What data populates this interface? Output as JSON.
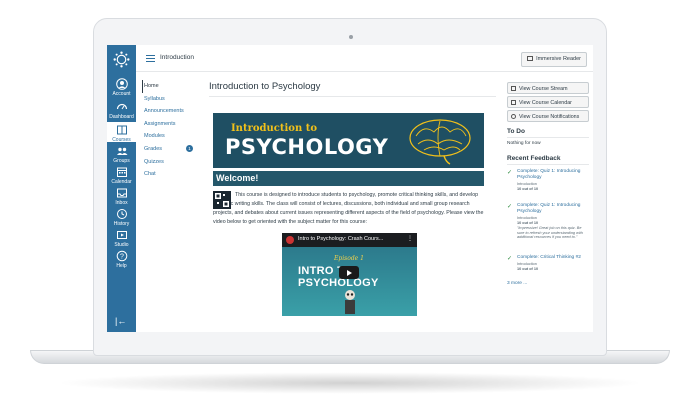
{
  "global_nav": {
    "items": [
      {
        "label": "Account",
        "icon": "account-icon"
      },
      {
        "label": "Dashboard",
        "icon": "dashboard-icon"
      },
      {
        "label": "Courses",
        "icon": "courses-icon"
      },
      {
        "label": "Groups",
        "icon": "groups-icon"
      },
      {
        "label": "Calendar",
        "icon": "calendar-icon"
      },
      {
        "label": "Inbox",
        "icon": "inbox-icon"
      },
      {
        "label": "History",
        "icon": "history-icon"
      },
      {
        "label": "Studio",
        "icon": "studio-icon"
      },
      {
        "label": "Help",
        "icon": "help-icon"
      }
    ],
    "active": "Courses",
    "collapse_glyph": "|←",
    "color": "#2d6f9e"
  },
  "header": {
    "breadcrumb": "Introduction",
    "immersive_reader": "Immersive Reader"
  },
  "course_nav": {
    "items": [
      {
        "label": "Home"
      },
      {
        "label": "Syllabus"
      },
      {
        "label": "Announcements"
      },
      {
        "label": "Assignments"
      },
      {
        "label": "Modules"
      },
      {
        "label": "Grades",
        "badge": "1"
      },
      {
        "label": "Quizzes"
      },
      {
        "label": "Chat"
      }
    ]
  },
  "main": {
    "page_title": "Introduction to Psychology",
    "banner_top": "Introduction to",
    "banner_main": "PSYCHOLOGY",
    "welcome": "Welcome!",
    "body": "This course is designed to introduce students to psychology, promote critical thinking skills, and develop scientific writing skills. The class will consist of lectures, discussions, both individual and small group research projects, and debates about current issues representing different aspects of the field of psychology. Please view the video below to get oriented with the subject matter for this course:",
    "video": {
      "title": "Intro to Psychology: Crash Cours...",
      "episode": "Episode 1",
      "headline": "INTRO TO PSYCHOLOGY"
    }
  },
  "sidebar": {
    "buttons": [
      {
        "label": "View Course Stream"
      },
      {
        "label": "View Course Calendar"
      },
      {
        "label": "View Course Notifications"
      }
    ],
    "todo_title": "To Do",
    "todo_empty": "Nothing for now",
    "feedback_title": "Recent Feedback",
    "feedback": [
      {
        "title": "Complete: Quiz 1: Introducing Psychology",
        "module": "Introduction",
        "score": "10 out of 10",
        "comment": ""
      },
      {
        "title": "Complete: Quiz 1: Introducing Psychology",
        "module": "Introduction",
        "score": "10 out of 10",
        "comment": "\"Impressive! Great job on this quiz. Be sure to refresh your understanding with additional resources if you need to.\""
      },
      {
        "title": "Complete: Critical Thinking #2",
        "module": "Introduction",
        "score": "10 out of 10",
        "comment": ""
      }
    ],
    "more": "3 more ..."
  }
}
